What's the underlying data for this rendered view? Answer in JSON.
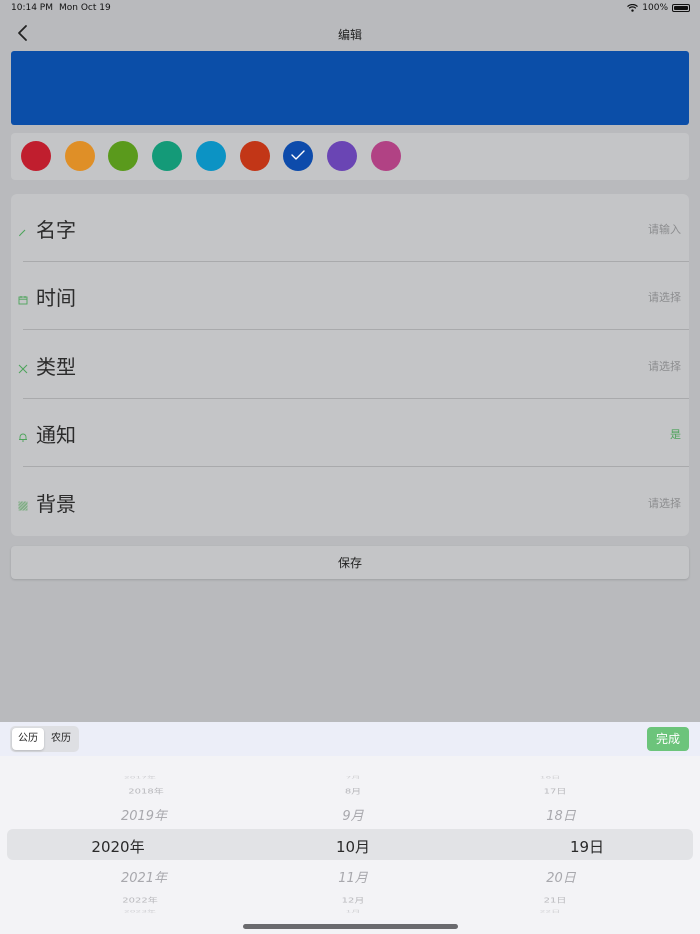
{
  "status_bar": {
    "time": "10:14 PM",
    "date": "Mon Oct 19",
    "battery": "100%"
  },
  "nav": {
    "title": "编辑"
  },
  "preview": {
    "color": "#0b4ea8"
  },
  "swatches": [
    {
      "name": "crimson",
      "color": "#c01e2e"
    },
    {
      "name": "orange",
      "color": "#df8f27"
    },
    {
      "name": "green",
      "color": "#5a9a1c"
    },
    {
      "name": "teal",
      "color": "#149a78"
    },
    {
      "name": "cyan",
      "color": "#0c93c4"
    },
    {
      "name": "red",
      "color": "#c23617"
    },
    {
      "name": "blue",
      "color": "#0d4bab",
      "selected": true
    },
    {
      "name": "purple",
      "color": "#6a45b4"
    },
    {
      "name": "magenta",
      "color": "#b14284"
    }
  ],
  "form": {
    "rows": [
      {
        "label": "名字",
        "value": "请输入",
        "icon": "pencil-icon",
        "value_color": "#8c8d8f"
      },
      {
        "label": "时间",
        "value": "请选择",
        "icon": "calendar-icon",
        "value_color": "#8c8d8f"
      },
      {
        "label": "类型",
        "value": "请选择",
        "icon": "tag-icon",
        "value_color": "#8c8d8f"
      },
      {
        "label": "通知",
        "value": "是",
        "icon": "bell-icon",
        "value_color": "#4ca35a"
      },
      {
        "label": "背景",
        "value": "请选择",
        "icon": "image-icon",
        "value_color": "#8c8d8f"
      }
    ]
  },
  "save": {
    "label": "保存"
  },
  "picker": {
    "segments": {
      "solar": "公历",
      "lunar": "农历",
      "active": "solar"
    },
    "done_label": "完成",
    "years": {
      "far_up": "2017年",
      "up2": "2018年",
      "up1": "2019年",
      "selected": "2020年",
      "down1": "2021年",
      "down2": "2022年",
      "far_down": "2023年"
    },
    "months": {
      "far_up": "7月",
      "up2": "8月",
      "up1": "9月",
      "selected": "10月",
      "down1": "11月",
      "down2": "12月",
      "far_down": "1月"
    },
    "days": {
      "far_up": "16日",
      "up2": "17日",
      "up1": "18日",
      "selected": "19日",
      "down1": "20日",
      "down2": "21日",
      "far_down": "22日"
    }
  },
  "colors": {
    "accent_green": "#6cc47b",
    "icon_green": "#4ca35a"
  }
}
